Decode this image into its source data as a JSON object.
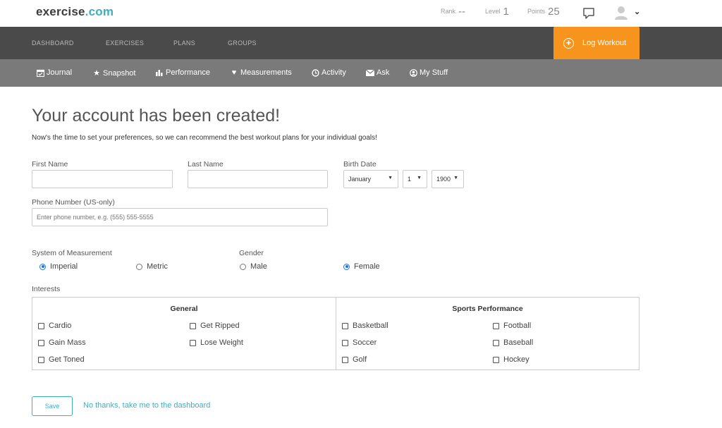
{
  "header": {
    "logo_main": "exercise",
    "logo_dot": ".",
    "logo_tld": "com",
    "rank_label": "Rank",
    "rank_value": "--",
    "level_label": "Level",
    "level_value": "1",
    "points_label": "Points",
    "points_value": "25"
  },
  "main_nav": {
    "items": [
      "DASHBOARD",
      "EXERCISES",
      "PLANS",
      "GROUPS"
    ],
    "log_workout": "Log Workout"
  },
  "sub_nav": {
    "items": [
      {
        "label": "Journal",
        "icon": "calendar-icon"
      },
      {
        "label": "Snapshot",
        "icon": "star-icon"
      },
      {
        "label": "Performance",
        "icon": "bar-chart-icon"
      },
      {
        "label": "Measurements",
        "icon": "heart-pulse-icon"
      },
      {
        "label": "Activity",
        "icon": "clock-icon"
      },
      {
        "label": "Ask",
        "icon": "envelope-icon"
      },
      {
        "label": "My Stuff",
        "icon": "user-circle-icon"
      }
    ]
  },
  "page": {
    "title": "Your account has been created!",
    "subtitle": "Now's the time to set your preferences, so we can recommend the best workout plans for your individual goals!"
  },
  "form": {
    "first_name_label": "First Name",
    "first_name_value": "",
    "last_name_label": "Last Name",
    "last_name_value": "",
    "birth_date_label": "Birth Date",
    "birth_month": "January",
    "birth_day": "1",
    "birth_year": "1900",
    "phone_label": "Phone Number (US-only)",
    "phone_placeholder": "Enter phone number, e.g. (555) 555-5555",
    "measurement_label": "System of Measurement",
    "measurement_options": [
      {
        "label": "Imperial",
        "selected": true
      },
      {
        "label": "Metric",
        "selected": false
      }
    ],
    "gender_label": "Gender",
    "gender_options": [
      {
        "label": "Male",
        "selected": false
      },
      {
        "label": "Female",
        "selected": true
      }
    ],
    "interests_label": "Interests",
    "general_heading": "General",
    "general_items": [
      "Cardio",
      "Get Ripped",
      "Gain Mass",
      "Lose Weight",
      "Get Toned"
    ],
    "sports_heading": "Sports Performance",
    "sports_items": [
      "Basketball",
      "Football",
      "Soccer",
      "Baseball",
      "Golf",
      "Hockey"
    ],
    "save_label": "Save",
    "skip_label": "No thanks, take me to the dashboard"
  },
  "colors": {
    "accent": "#3ab0c4",
    "orange": "#f7941d",
    "nav_dark": "#4a4a4a",
    "nav_sub": "#7a7a7a"
  }
}
